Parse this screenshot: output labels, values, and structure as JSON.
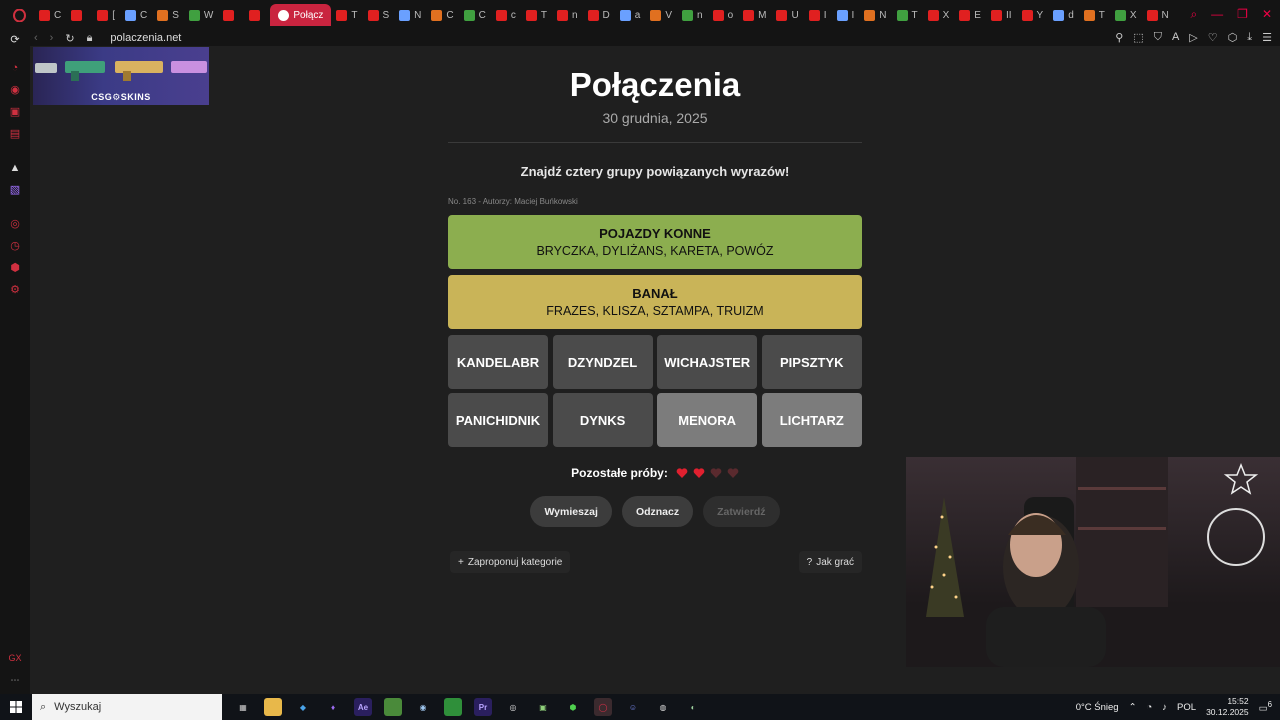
{
  "browser": {
    "url": "polaczenia.net",
    "active_tab_label": "Połącz",
    "tabs": [
      "C",
      "",
      "[",
      "C",
      "S",
      "W",
      "",
      "",
      "T",
      "S",
      "N",
      "C",
      "C",
      "c",
      "T",
      "n",
      "D",
      "a",
      "V",
      "n",
      "o",
      "M",
      "U",
      "I",
      "I",
      "N",
      "T",
      "X",
      "E",
      "II",
      "Y",
      "d",
      "T",
      "X",
      "N"
    ]
  },
  "ad": {
    "brand": "CSG⚙SKINS"
  },
  "page": {
    "title": "Połączenia",
    "date": "30 grudnia, 2025",
    "instructions": "Znajdź cztery grupy powiązanych wyrazów!",
    "meta": "No. 163 - Autorzy: Maciej Buńkowski"
  },
  "solved_groups": [
    {
      "name": "POJAZDY KONNE",
      "words": "BRYCZKA, DYLIŻANS, KARETA, POWÓZ",
      "color": "#8cae4f"
    },
    {
      "name": "BANAŁ",
      "words": "FRAZES, KLISZA, SZTAMPA, TRUIZM",
      "color": "#c9b458"
    }
  ],
  "tiles": [
    {
      "word": "KANDELABR",
      "selected": false
    },
    {
      "word": "DZYNDZEL",
      "selected": false
    },
    {
      "word": "WICHAJSTER",
      "selected": false
    },
    {
      "word": "PIPSZTYK",
      "selected": false
    },
    {
      "word": "PANICHIDNIK",
      "selected": false
    },
    {
      "word": "DYNKS",
      "selected": false
    },
    {
      "word": "MENORA",
      "selected": true
    },
    {
      "word": "LICHTARZ",
      "selected": true
    }
  ],
  "attempts": {
    "label": "Pozostałe próby:",
    "remaining": 2,
    "total": 4
  },
  "buttons": {
    "shuffle": "Wymieszaj",
    "deselect": "Odznacz",
    "submit": "Zatwierdź"
  },
  "links": {
    "suggest": "Zaproponuj kategorie",
    "how_to": "Jak grać"
  },
  "taskbar": {
    "search_placeholder": "Wyszukaj",
    "weather": "0°C  Śnieg",
    "language": "POL",
    "time": "15:52",
    "date": "30.12.2025",
    "notifications": "6"
  }
}
